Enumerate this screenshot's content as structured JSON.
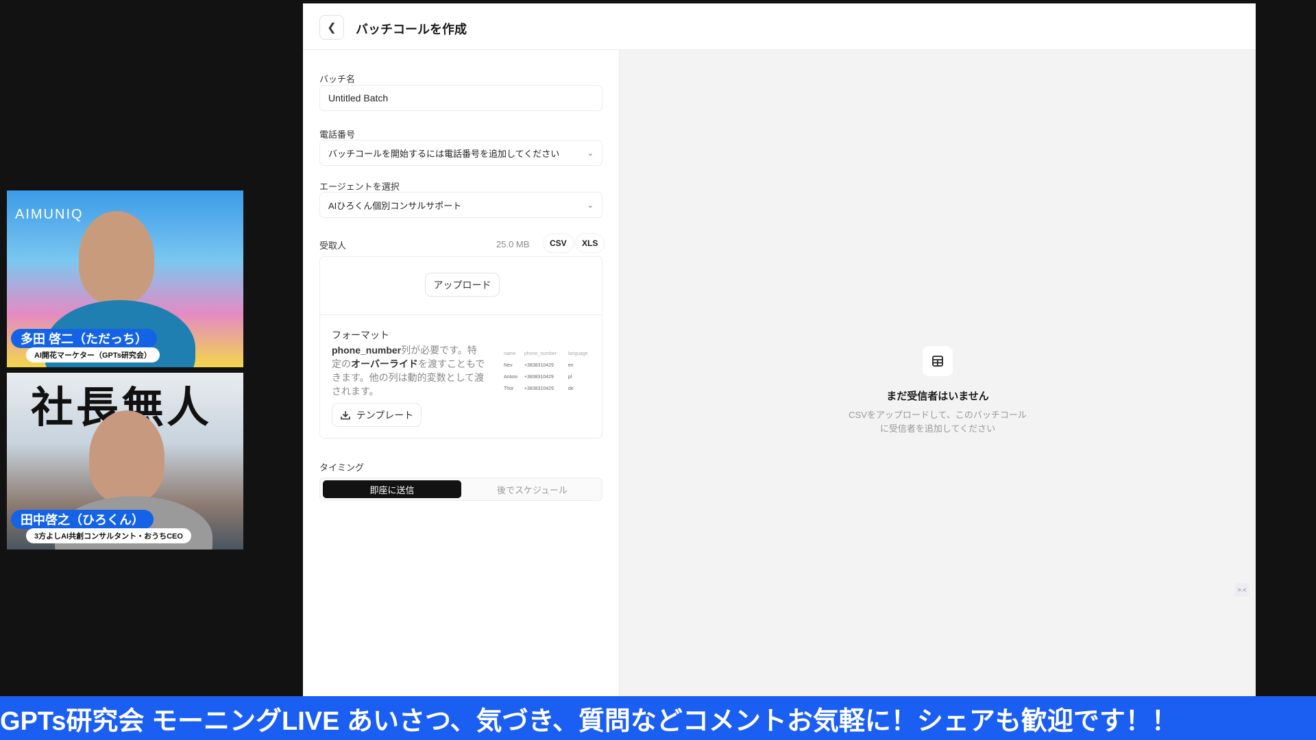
{
  "header": {
    "title": "バッチコールを作成",
    "back_icon": "chevron-left-icon"
  },
  "form": {
    "batch_name": {
      "label": "バッチ名",
      "value": "Untitled Batch"
    },
    "phone": {
      "label": "電話番号",
      "placeholder": "バッチコールを開始するには電話番号を追加してください"
    },
    "agent": {
      "label": "エージェントを選択",
      "value": "AIひろくん個別コンサルサポート"
    },
    "recipients": {
      "label": "受取人",
      "max_size": "25.0 MB",
      "formats": [
        "CSV",
        "XLS"
      ],
      "upload_label": "アップロード",
      "format_title": "フォーマット",
      "format_desc_1": "phone_number",
      "format_desc_2": "列が必要です。特定の",
      "format_desc_3": "オーバーライド",
      "format_desc_4": "を渡すこともできます。他の列は動的変数として渡されます。",
      "template_label": "テンプレート",
      "sample_table": {
        "headers": [
          "name",
          "phone_number",
          "language"
        ],
        "rows": [
          [
            "Nev",
            "+3838310429",
            "en"
          ],
          [
            "Antoni",
            "+3838310429",
            "pl"
          ],
          [
            "Thor",
            "+3838310429",
            "de"
          ]
        ]
      }
    },
    "timing": {
      "label": "タイミング",
      "options": [
        "即座に送信",
        "後でスケジュール"
      ],
      "selected": "即座に送信"
    }
  },
  "empty_state": {
    "icon": "table-icon",
    "title": "まだ受信者はいません",
    "description": "CSVをアップロードして、このバッチコールに受信者を追加してください"
  },
  "videos": [
    {
      "name": "多田 啓二（ただっち）",
      "role": "AI開花マーケター（GPTs研究会）",
      "background_text": "AIMUNIQ"
    },
    {
      "name": "田中啓之（ひろくん）",
      "role": "3方よしAI共創コンサルタント・おうちCEO",
      "background_text": "社長無人"
    }
  ],
  "ticker": {
    "text": "GPTs研究会 モーニングLIVE あいさつ、気づき、質問などコメントお気軽に！シェアも歓迎です！！"
  }
}
